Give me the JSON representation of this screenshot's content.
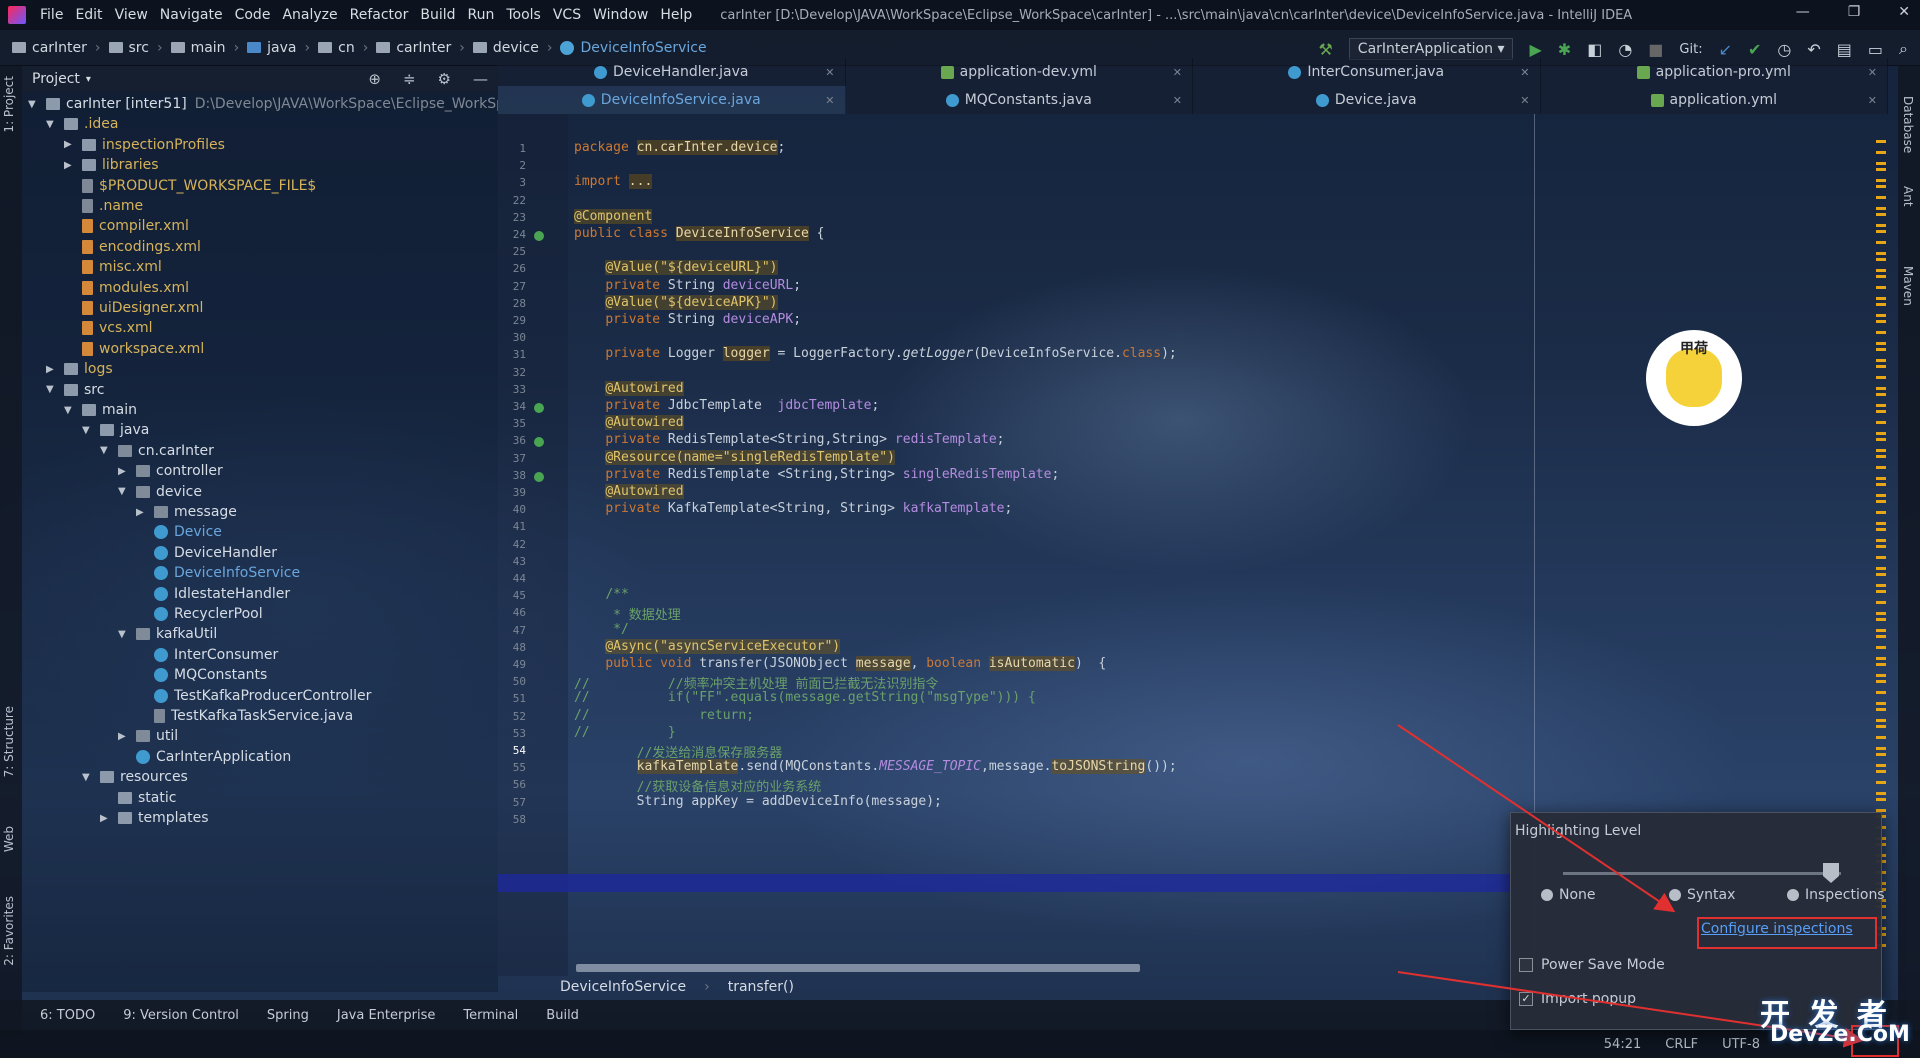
{
  "menubar": {
    "items": [
      "File",
      "Edit",
      "View",
      "Navigate",
      "Code",
      "Analyze",
      "Refactor",
      "Build",
      "Run",
      "Tools",
      "VCS",
      "Window",
      "Help"
    ],
    "title": "carInter [D:\\Develop\\JAVA\\WorkSpace\\Eclipse_WorkSpace\\carInter] - ...\\src\\main\\java\\cn\\carInter\\device\\DeviceInfoService.java - IntelliJ IDEA"
  },
  "navbar": {
    "crumbs": [
      "carInter",
      "src",
      "main",
      "java",
      "cn",
      "carInter",
      "device",
      "DeviceInfoService"
    ],
    "run_config": "CarInterApplication",
    "git_label": "Git:"
  },
  "project_panel": {
    "title": "Project",
    "tree": [
      {
        "label": "carInter [inter51]",
        "extra": "D:\\Develop\\JAVA\\WorkSpace\\Eclipse_WorkSpace",
        "depth": 0,
        "arrow": "down",
        "icon": "folder",
        "color": "white"
      },
      {
        "label": ".idea",
        "depth": 1,
        "arrow": "down",
        "icon": "folder",
        "color": "yellow"
      },
      {
        "label": "inspectionProfiles",
        "depth": 2,
        "arrow": "right",
        "icon": "folder",
        "color": "yellow"
      },
      {
        "label": "libraries",
        "depth": 2,
        "arrow": "right",
        "icon": "folder",
        "color": "yellow"
      },
      {
        "label": "$PRODUCT_WORKSPACE_FILE$",
        "depth": 2,
        "arrow": "",
        "icon": "file",
        "color": "yellow"
      },
      {
        "label": ".name",
        "depth": 2,
        "arrow": "",
        "icon": "file",
        "color": "yellow"
      },
      {
        "label": "compiler.xml",
        "depth": 2,
        "arrow": "",
        "icon": "xml",
        "color": "yellow"
      },
      {
        "label": "encodings.xml",
        "depth": 2,
        "arrow": "",
        "icon": "xml",
        "color": "yellow"
      },
      {
        "label": "misc.xml",
        "depth": 2,
        "arrow": "",
        "icon": "xml",
        "color": "yellow"
      },
      {
        "label": "modules.xml",
        "depth": 2,
        "arrow": "",
        "icon": "xml",
        "color": "yellow"
      },
      {
        "label": "uiDesigner.xml",
        "depth": 2,
        "arrow": "",
        "icon": "xml",
        "color": "yellow"
      },
      {
        "label": "vcs.xml",
        "depth": 2,
        "arrow": "",
        "icon": "xml",
        "color": "yellow"
      },
      {
        "label": "workspace.xml",
        "depth": 2,
        "arrow": "",
        "icon": "xml",
        "color": "yellow"
      },
      {
        "label": "logs",
        "depth": 1,
        "arrow": "right",
        "icon": "folder",
        "color": "yellow"
      },
      {
        "label": "src",
        "depth": 1,
        "arrow": "down",
        "icon": "folder",
        "color": "white"
      },
      {
        "label": "main",
        "depth": 2,
        "arrow": "down",
        "icon": "folder",
        "color": "white"
      },
      {
        "label": "java",
        "depth": 3,
        "arrow": "down",
        "icon": "folder",
        "color": "white"
      },
      {
        "label": "cn.carInter",
        "depth": 4,
        "arrow": "down",
        "icon": "pkg",
        "color": "white"
      },
      {
        "label": "controller",
        "depth": 5,
        "arrow": "right",
        "icon": "pkg",
        "color": "white"
      },
      {
        "label": "device",
        "depth": 5,
        "arrow": "down",
        "icon": "pkg",
        "color": "white"
      },
      {
        "label": "message",
        "depth": 6,
        "arrow": "right",
        "icon": "pkg",
        "color": "white"
      },
      {
        "label": "Device",
        "depth": 6,
        "arrow": "",
        "icon": "class",
        "color": "blue"
      },
      {
        "label": "DeviceHandler",
        "depth": 6,
        "arrow": "",
        "icon": "class",
        "color": "white"
      },
      {
        "label": "DeviceInfoService",
        "depth": 6,
        "arrow": "",
        "icon": "class",
        "color": "blue"
      },
      {
        "label": "IdlestateHandler",
        "depth": 6,
        "arrow": "",
        "icon": "class",
        "color": "white"
      },
      {
        "label": "RecyclerPool",
        "depth": 6,
        "arrow": "",
        "icon": "class",
        "color": "white"
      },
      {
        "label": "kafkaUtil",
        "depth": 5,
        "arrow": "down",
        "icon": "pkg",
        "color": "white"
      },
      {
        "label": "InterConsumer",
        "depth": 6,
        "arrow": "",
        "icon": "class",
        "color": "white"
      },
      {
        "label": "MQConstants",
        "depth": 6,
        "arrow": "",
        "icon": "class",
        "color": "white"
      },
      {
        "label": "TestKafkaProducerController",
        "depth": 6,
        "arrow": "",
        "icon": "class",
        "color": "white"
      },
      {
        "label": "TestKafkaTaskService.java",
        "depth": 6,
        "arrow": "",
        "icon": "file",
        "color": "white"
      },
      {
        "label": "util",
        "depth": 5,
        "arrow": "right",
        "icon": "pkg",
        "color": "white"
      },
      {
        "label": "CarInterApplication",
        "depth": 5,
        "arrow": "",
        "icon": "class",
        "color": "white"
      },
      {
        "label": "resources",
        "depth": 3,
        "arrow": "down",
        "icon": "folder",
        "color": "white"
      },
      {
        "label": "static",
        "depth": 4,
        "arrow": "",
        "icon": "folder",
        "color": "white"
      },
      {
        "label": "templates",
        "depth": 4,
        "arrow": "right",
        "icon": "folder",
        "color": "white"
      }
    ]
  },
  "tabs_row1": [
    {
      "label": "DeviceHandler.java",
      "type": "class",
      "active": false
    },
    {
      "label": "application-dev.yml",
      "type": "yml",
      "active": false
    },
    {
      "label": "InterConsumer.java",
      "type": "class",
      "active": false
    },
    {
      "label": "application-pro.yml",
      "type": "yml",
      "active": false
    }
  ],
  "tabs_row2": [
    {
      "label": "DeviceInfoService.java",
      "type": "class",
      "active": true
    },
    {
      "label": "MQConstants.java",
      "type": "class",
      "active": false
    },
    {
      "label": "Device.java",
      "type": "class",
      "active": false
    },
    {
      "label": "application.yml",
      "type": "yml",
      "active": false
    }
  ],
  "code": {
    "lines": [
      {
        "n": "1",
        "html": "<span class=\"kw\">package</span> <span class=\"hl\">cn.carInter.device</span>;"
      },
      {
        "n": "2",
        "html": ""
      },
      {
        "n": "3",
        "html": "<span class=\"kw\">import</span> <span class=\"hl\">...</span>"
      },
      {
        "n": "22",
        "html": ""
      },
      {
        "n": "23",
        "html": "<span class=\"ann\">@Component</span>"
      },
      {
        "n": "24",
        "html": "<span class=\"kw\">public class</span> <span class=\"hl\">DeviceInfoService</span> {"
      },
      {
        "n": "25",
        "html": ""
      },
      {
        "n": "26",
        "html": "    <span class=\"ann\">@Value(\"${deviceURL}\")</span>"
      },
      {
        "n": "27",
        "html": "    <span class=\"kw\">private</span> String <span class=\"fld\">deviceURL</span>;"
      },
      {
        "n": "28",
        "html": "    <span class=\"ann\">@Value(\"${deviceAPK}\")</span>"
      },
      {
        "n": "29",
        "html": "    <span class=\"kw\">private</span> String <span class=\"fld\">deviceAPK</span>;"
      },
      {
        "n": "30",
        "html": ""
      },
      {
        "n": "31",
        "html": "    <span class=\"kw\">private</span> Logger <span class=\"hl\">logger</span> = LoggerFactory.<i>getLogger</i>(DeviceInfoService.<span class=\"kw\">class</span>);"
      },
      {
        "n": "32",
        "html": ""
      },
      {
        "n": "33",
        "html": "    <span class=\"ann\">@Autowired</span>"
      },
      {
        "n": "34",
        "html": "    <span class=\"kw\">private</span> JdbcTemplate  <span class=\"fld\">jdbcTemplate</span>;"
      },
      {
        "n": "35",
        "html": "    <span class=\"ann\">@Autowired</span>"
      },
      {
        "n": "36",
        "html": "    <span class=\"kw\">private</span> RedisTemplate&lt;String,String&gt; <span class=\"fld\">redisTemplate</span>;"
      },
      {
        "n": "37",
        "html": "    <span class=\"ann\">@Resource(name=\"singleRedisTemplate\")</span>"
      },
      {
        "n": "38",
        "html": "    <span class=\"kw\">private</span> RedisTemplate &lt;String,String&gt; <span class=\"fld\">singleRedisTemplate</span>;"
      },
      {
        "n": "39",
        "html": "    <span class=\"ann\">@Autowired</span>"
      },
      {
        "n": "40",
        "html": "    <span class=\"kw\">private</span> KafkaTemplate&lt;String, String&gt; <span class=\"fld\">kafkaTemplate</span>;"
      },
      {
        "n": "41",
        "html": ""
      },
      {
        "n": "42",
        "html": ""
      },
      {
        "n": "43",
        "html": ""
      },
      {
        "n": "44",
        "html": ""
      },
      {
        "n": "45",
        "html": "    <span class=\"cmt\">/**</span>"
      },
      {
        "n": "46",
        "html": "    <span class=\"cmt\"> * 数据处理</span>"
      },
      {
        "n": "47",
        "html": "    <span class=\"cmt\"> */</span>"
      },
      {
        "n": "48",
        "html": "    <span class=\"ann\">@Async(\"asyncServiceExecutor\")</span>"
      },
      {
        "n": "49",
        "html": "    <span class=\"kw\">public void</span> transfer(JSONObject <span class=\"hl\">message</span>, <span class=\"kw\">boolean</span> <span class=\"hl\">isAutomatic</span>)  {"
      },
      {
        "n": "50",
        "html": "<span class=\"cmt\">//          //频率冲突主机处理 前面已拦截无法识别指令</span>"
      },
      {
        "n": "51",
        "html": "<span class=\"cmt\">//          if(\"FF\".equals(message.getString(\"msgType\"))) {</span>"
      },
      {
        "n": "52",
        "html": "<span class=\"cmt\">//              return;</span>"
      },
      {
        "n": "53",
        "html": "<span class=\"cmt\">//          }</span>"
      },
      {
        "n": "54",
        "html": "        <span class=\"cmt\">//发送给消息保存服务器</span>"
      },
      {
        "n": "55",
        "html": "        <span class=\"hl\">kafkaTemplate</span>.send(MQConstants.<i class=\"fld\">MESSAGE_TOPIC</i>,message.<span class=\"hl\">toJSONString</span>());"
      },
      {
        "n": "56",
        "html": "        <span class=\"cmt\">//获取设备信息对应的业务系统</span>"
      },
      {
        "n": "57",
        "html": "        String appKey = addDeviceInfo(message);"
      },
      {
        "n": "58",
        "html": ""
      }
    ],
    "breadcrumb": [
      "DeviceInfoService",
      "transfer()"
    ]
  },
  "right_strip": [
    "Database",
    "Ant",
    "Maven"
  ],
  "left_strip": [
    "1: Project",
    "7: Structure",
    "Web",
    "2: Favorites"
  ],
  "bottom_bar": [
    "6: TODO",
    "9: Version Control",
    "Spring",
    "Java Enterprise",
    "Terminal",
    "Build"
  ],
  "status_bar": {
    "position": "54:21",
    "line_sep": "CRLF",
    "encoding": "UTF-8"
  },
  "popup": {
    "title": "Highlighting Level",
    "levels": [
      "None",
      "Syntax",
      "Inspections"
    ],
    "level_value": "Inspections",
    "configure_link": "Configure inspections",
    "power_save": "Power Save Mode",
    "power_save_checked": false,
    "import_popup": "Import popup",
    "import_popup_checked": true
  },
  "watermark": {
    "line1": "开 发 者",
    "line2": "DevZe.CoM"
  },
  "mascot_text": "甲荷",
  "colors": {
    "accent": "#589df6",
    "annotation_box": "#e03030",
    "marker": "#e8a514"
  }
}
